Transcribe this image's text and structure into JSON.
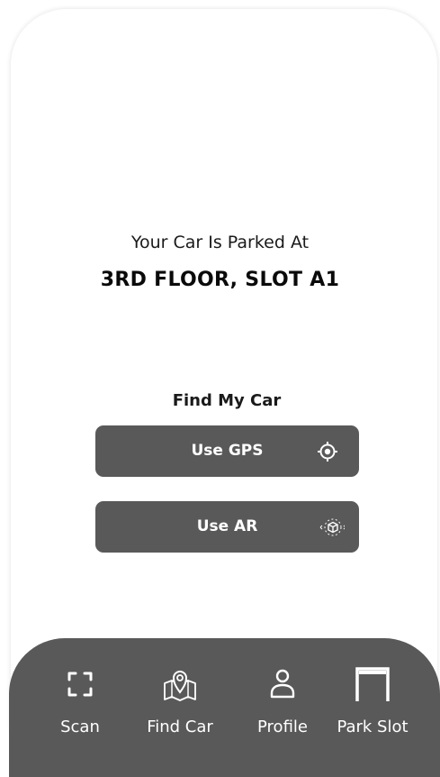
{
  "status": {
    "parked_label": "Your Car Is Parked At",
    "location": "3RD FLOOR, SLOT A1"
  },
  "find": {
    "title": "Find My Car",
    "gps_label": "Use GPS",
    "gps_icon": "locate-icon",
    "ar_label": "Use AR",
    "ar_icon": "ar-cube-icon"
  },
  "nav": {
    "items": [
      {
        "label": "Scan",
        "icon": "scan-icon"
      },
      {
        "label": "Find Car",
        "icon": "map-pin-icon"
      },
      {
        "label": "Profile",
        "icon": "user-icon"
      },
      {
        "label": "Park Slot",
        "icon": "parking-slot-icon"
      }
    ]
  },
  "colors": {
    "background": "#ffffff",
    "button": "#595959",
    "nav_bar": "#595959",
    "text": "#1a1a1a"
  }
}
